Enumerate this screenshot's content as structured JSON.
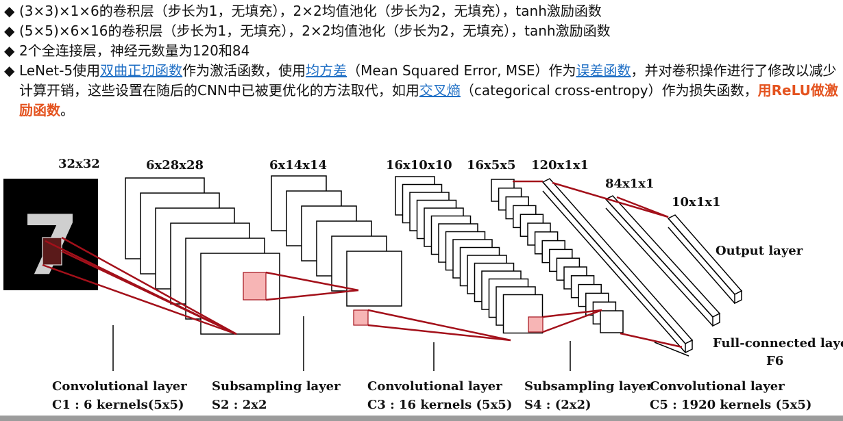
{
  "bullets": {
    "b1": "(3×3)×1×6的卷积层（步长为1，无填充），2×2均值池化（步长为2，无填充），tanh激励函数",
    "b2": "(5×5)×6×16的卷积层（步长为1，无填充），2×2均值池化（步长为2，无填充），tanh激励函数",
    "b3": "2个全连接层，神经元数量为120和84",
    "b4_t1": "LeNet-5使用",
    "b4_l1": "双曲正切函数",
    "b4_t2": "作为激活函数，使用",
    "b4_l2": "均方差",
    "b4_t3": "（Mean Squared Error, MSE）作为",
    "b4_l3": "误差函数",
    "b4_t4": "，并对卷积操作进行了修改以减少计算开销，这些设置在随后的CNN中已被更优化的方法取代，如用",
    "b4_l4": "交叉熵",
    "b4_t5": "（categorical cross-entropy）作为损失函数，",
    "b4_red": "用ReLU做激励函数",
    "b4_t6": "。",
    "bullet_symbol": "◆"
  },
  "diagram": {
    "dims": {
      "input": "32x32",
      "c1": "6x28x28",
      "s2": "6x14x14",
      "c3": "16x10x10",
      "s4": "16x5x5",
      "c5": "120x1x1",
      "f6": "84x1x1",
      "out": "10x1x1"
    },
    "digit": "7",
    "layers": {
      "c1_name": "Convolutional layer",
      "c1_desc": "C1 : 6 kernels(5x5)",
      "s2_name": "Subsampling layer",
      "s2_desc": "S2 : 2x2",
      "c3_name": "Convolutional layer",
      "c3_desc": "C3 : 16 kernels (5x5)",
      "s4_name": "Subsampling layer",
      "s4_desc": "S4 : (2x2)",
      "c5_name": "Convolutional layer",
      "c5_desc": "C5 : 1920 kernels (5x5)",
      "output": "Output layer",
      "fc1": "Full-connected layer",
      "fc2": "F6"
    },
    "colors": {
      "line": "#a3101a",
      "patch": "#f7b5b5",
      "bullet_link": "#1f6fc5",
      "highlight": "#e4531f"
    }
  }
}
